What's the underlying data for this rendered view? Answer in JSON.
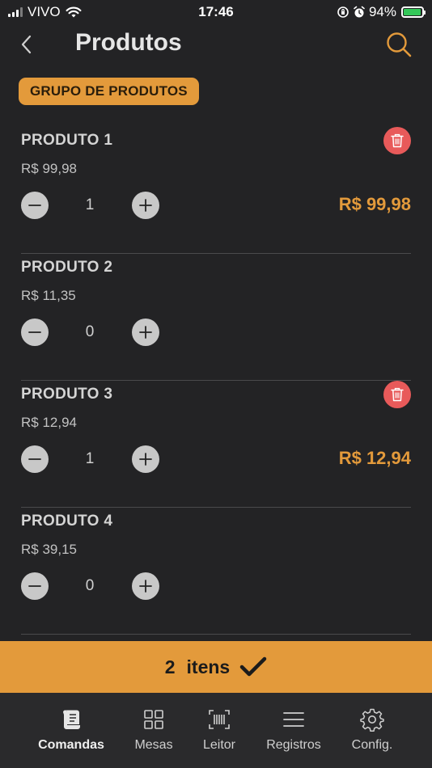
{
  "status_bar": {
    "carrier": "VIVO",
    "time": "17:46",
    "battery": "94%",
    "battery_level": 0.94
  },
  "header": {
    "title": "Produtos"
  },
  "group": {
    "label": "GRUPO DE PRODUTOS"
  },
  "products": [
    {
      "name": "PRODUTO 1",
      "price": "R$ 99,98",
      "quantity": "1",
      "total": "R$ 99,98"
    },
    {
      "name": "PRODUTO 2",
      "price": "R$ 11,35",
      "quantity": "0",
      "total": ""
    },
    {
      "name": "PRODUTO 3",
      "price": "R$ 12,94",
      "quantity": "1",
      "total": "R$ 12,94"
    },
    {
      "name": "PRODUTO 4",
      "price": "R$ 39,15",
      "quantity": "0",
      "total": ""
    }
  ],
  "confirm": {
    "count": "2",
    "label": "itens"
  },
  "tabs": [
    {
      "label": "Comandas",
      "icon": "receipt-scroll-icon",
      "active": true
    },
    {
      "label": "Mesas",
      "icon": "grid-icon",
      "active": false
    },
    {
      "label": "Leitor",
      "icon": "barcode-scan-icon",
      "active": false
    },
    {
      "label": "Registros",
      "icon": "menu-lines-icon",
      "active": false
    },
    {
      "label": "Config.",
      "icon": "gear-icon",
      "active": false
    }
  ],
  "colors": {
    "background": "#232325",
    "accent": "#e39a3b",
    "delete": "#e85a5a"
  }
}
